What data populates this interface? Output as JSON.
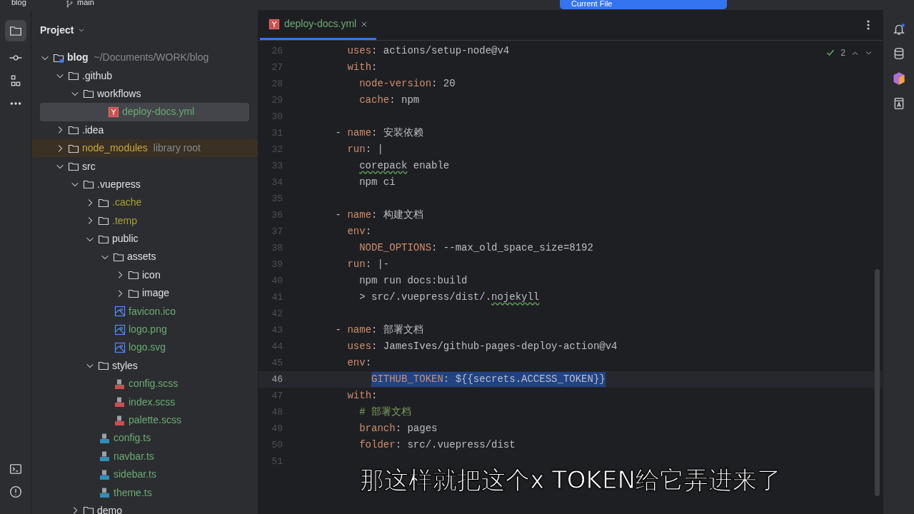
{
  "top_bar": {
    "project": "blog",
    "branch": "main",
    "run_config": "Current File"
  },
  "project_panel": {
    "title": "Project",
    "tree": [
      {
        "name": "blog",
        "hint": "~/Documents/WORK/blog",
        "kind": "root",
        "expanded": true,
        "color": "#dfe1e5",
        "selected": false,
        "children": [
          {
            "name": ".github",
            "kind": "folder",
            "expanded": true,
            "color": "#dfe1e5",
            "selected": false,
            "children": [
              {
                "name": "workflows",
                "kind": "folder",
                "expanded": true,
                "color": "#dfe1e5",
                "selected": false,
                "children": [
                  {
                    "name": "deploy-docs.yml",
                    "kind": "yaml",
                    "color": "#6aab73",
                    "selected": true
                  }
                ]
              }
            ]
          },
          {
            "name": ".idea",
            "kind": "folder",
            "expanded": false,
            "color": "#dfe1e5",
            "selected": false
          },
          {
            "name": "node_modules",
            "hint": "library root",
            "kind": "folder",
            "expanded": false,
            "color": "#c9a842",
            "selected": false
          },
          {
            "name": "src",
            "kind": "folder",
            "expanded": true,
            "color": "#dfe1e5",
            "selected": false,
            "children": [
              {
                "name": ".vuepress",
                "kind": "folder",
                "expanded": true,
                "color": "#dfe1e5",
                "selected": false,
                "children": [
                  {
                    "name": ".cache",
                    "kind": "folder",
                    "expanded": false,
                    "color": "#a9a334",
                    "selected": false
                  },
                  {
                    "name": ".temp",
                    "kind": "folder",
                    "expanded": false,
                    "color": "#a9a334",
                    "selected": false
                  },
                  {
                    "name": "public",
                    "kind": "folder",
                    "expanded": true,
                    "color": "#dfe1e5",
                    "selected": false,
                    "children": [
                      {
                        "name": "assets",
                        "kind": "folder",
                        "expanded": true,
                        "color": "#dfe1e5",
                        "selected": false,
                        "children": [
                          {
                            "name": "icon",
                            "kind": "folder",
                            "expanded": false,
                            "color": "#dfe1e5",
                            "selected": false
                          },
                          {
                            "name": "image",
                            "kind": "folder",
                            "expanded": false,
                            "color": "#dfe1e5",
                            "selected": false
                          }
                        ]
                      },
                      {
                        "name": "favicon.ico",
                        "kind": "image",
                        "color": "#6aab73",
                        "selected": false
                      },
                      {
                        "name": "logo.png",
                        "kind": "image",
                        "color": "#6aab73",
                        "selected": false
                      },
                      {
                        "name": "logo.svg",
                        "kind": "image",
                        "color": "#6aab73",
                        "selected": false
                      }
                    ]
                  },
                  {
                    "name": "styles",
                    "kind": "folder",
                    "expanded": true,
                    "color": "#dfe1e5",
                    "selected": false,
                    "children": [
                      {
                        "name": "config.scss",
                        "kind": "sass",
                        "color": "#6aab73",
                        "selected": false
                      },
                      {
                        "name": "index.scss",
                        "kind": "sass",
                        "color": "#6aab73",
                        "selected": false
                      },
                      {
                        "name": "palette.scss",
                        "kind": "sass",
                        "color": "#6aab73",
                        "selected": false
                      }
                    ]
                  },
                  {
                    "name": "config.ts",
                    "kind": "ts",
                    "color": "#6aab73",
                    "selected": false
                  },
                  {
                    "name": "navbar.ts",
                    "kind": "ts",
                    "color": "#6aab73",
                    "selected": false
                  },
                  {
                    "name": "sidebar.ts",
                    "kind": "ts",
                    "color": "#6aab73",
                    "selected": false
                  },
                  {
                    "name": "theme.ts",
                    "kind": "ts",
                    "color": "#6aab73",
                    "selected": false
                  }
                ]
              },
              {
                "name": "demo",
                "kind": "folder",
                "expanded": false,
                "color": "#dfe1e5",
                "selected": false
              }
            ]
          }
        ]
      }
    ]
  },
  "editor": {
    "tabs": [
      {
        "label": "deploy-docs.yml",
        "kind": "yaml",
        "selected": true
      }
    ],
    "inspection_count": "2",
    "lines": [
      {
        "number": "26",
        "selected": false,
        "tokens": [
          {
            "kind": "key",
            "text": "      uses"
          },
          {
            "kind": "plain",
            "text": ": actions/setup-node@v4"
          }
        ]
      },
      {
        "number": "27",
        "selected": false,
        "tokens": [
          {
            "kind": "key",
            "text": "      with"
          },
          {
            "kind": "plain",
            "text": ":"
          }
        ]
      },
      {
        "number": "28",
        "selected": false,
        "tokens": [
          {
            "kind": "key",
            "text": "        node-version"
          },
          {
            "kind": "plain",
            "text": ": 20"
          }
        ]
      },
      {
        "number": "29",
        "selected": false,
        "tokens": [
          {
            "kind": "key",
            "text": "        cache"
          },
          {
            "kind": "plain",
            "text": ": npm"
          }
        ]
      },
      {
        "number": "30",
        "selected": false
      },
      {
        "number": "31",
        "selected": false,
        "tokens": [
          {
            "kind": "plain",
            "text": "    - "
          },
          {
            "kind": "key",
            "text": "name"
          },
          {
            "kind": "plain",
            "text": ": 安装依赖"
          }
        ]
      },
      {
        "number": "32",
        "selected": false,
        "tokens": [
          {
            "kind": "key",
            "text": "      run"
          },
          {
            "kind": "plain",
            "text": ": |"
          }
        ]
      },
      {
        "number": "33",
        "selected": false,
        "tokens": [
          {
            "kind": "typo",
            "text": "        corepack"
          },
          {
            "kind": "plain",
            "text": " enable"
          }
        ]
      },
      {
        "number": "34",
        "selected": false,
        "tokens": [
          {
            "kind": "plain",
            "text": "        npm ci"
          }
        ]
      },
      {
        "number": "35",
        "selected": false
      },
      {
        "number": "36",
        "selected": false,
        "tokens": [
          {
            "kind": "plain",
            "text": "    - "
          },
          {
            "kind": "key",
            "text": "name"
          },
          {
            "kind": "plain",
            "text": ": 构建文档"
          }
        ]
      },
      {
        "number": "37",
        "selected": false,
        "tokens": [
          {
            "kind": "key",
            "text": "      env"
          },
          {
            "kind": "plain",
            "text": ":"
          }
        ]
      },
      {
        "number": "38",
        "selected": false,
        "tokens": [
          {
            "kind": "key",
            "text": "        NODE_OPTIONS"
          },
          {
            "kind": "plain",
            "text": ": --max_old_space_size=8192"
          }
        ]
      },
      {
        "number": "39",
        "selected": false,
        "tokens": [
          {
            "kind": "key",
            "text": "      run"
          },
          {
            "kind": "plain",
            "text": ": |-"
          }
        ]
      },
      {
        "number": "40",
        "selected": false,
        "tokens": [
          {
            "kind": "plain",
            "text": "        npm run docs:build"
          }
        ]
      },
      {
        "number": "41",
        "selected": false,
        "tokens": [
          {
            "kind": "plain",
            "text": "        > src/.vuepress/dist/."
          },
          {
            "kind": "typo",
            "text": "nojekyll"
          }
        ]
      },
      {
        "number": "42",
        "selected": false
      },
      {
        "number": "43",
        "selected": false,
        "tokens": [
          {
            "kind": "plain",
            "text": "    - "
          },
          {
            "kind": "key",
            "text": "name"
          },
          {
            "kind": "plain",
            "text": ": 部署文档"
          }
        ]
      },
      {
        "number": "44",
        "selected": false,
        "tokens": [
          {
            "kind": "key",
            "text": "      uses"
          },
          {
            "kind": "plain",
            "text": ": JamesIves/github-pages-deploy-action@v4"
          }
        ]
      },
      {
        "number": "45",
        "selected": false,
        "tokens": [
          {
            "kind": "key",
            "text": "      env"
          },
          {
            "kind": "plain",
            "text": ":"
          }
        ]
      },
      {
        "number": "46",
        "selected": true,
        "tokens": [
          {
            "kind": "key",
            "text": "          GITHUB_TOKEN"
          },
          {
            "kind": "plain",
            "text": ": ${{secrets.ACCESS_TOKEN}}"
          }
        ]
      },
      {
        "number": "47",
        "selected": false,
        "tokens": [
          {
            "kind": "key",
            "text": "      with"
          },
          {
            "kind": "plain",
            "text": ":"
          }
        ]
      },
      {
        "number": "48",
        "selected": false,
        "tokens": [
          {
            "kind": "comment",
            "text": "        # 部署文档"
          }
        ]
      },
      {
        "number": "49",
        "selected": false,
        "tokens": [
          {
            "kind": "key",
            "text": "        branch"
          },
          {
            "kind": "plain",
            "text": ": pages"
          }
        ]
      },
      {
        "number": "50",
        "selected": false,
        "tokens": [
          {
            "kind": "key",
            "text": "        folder"
          },
          {
            "kind": "plain",
            "text": ": src/.vuepress/dist"
          }
        ]
      },
      {
        "number": "51",
        "selected": false
      }
    ]
  },
  "subtitle": "那这样就把这个x TOKEN给它弄进来了"
}
